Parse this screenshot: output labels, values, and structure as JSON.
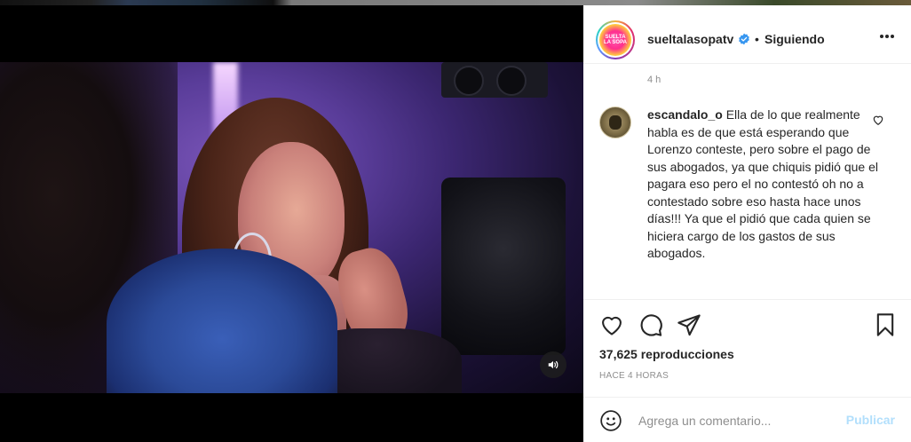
{
  "post": {
    "username": "sueltalasopatv",
    "follow_status": "Siguiendo",
    "separator": "•",
    "avatar_text": "SUELTA LA SOPA",
    "verified_icon": "verified-badge-icon",
    "more_icon": "more-options-icon"
  },
  "comments": {
    "cut_time": "4 h",
    "items": [
      {
        "username": "escandalo_o",
        "text": "Ella de lo que realmente habla es de que está esperando que Lorenzo conteste, pero sobre el pago de sus abogados, ya que chiquis pidió que el pagara eso pero el no contestó oh no a contestado sobre eso hasta hace unos días!!! Ya que el pidió que cada quien se hiciera cargo de los gastos de sus abogados."
      }
    ]
  },
  "actions": {
    "views_count": "37,625",
    "views_label": "reproducciones",
    "time_ago": "HACE 4 HORAS",
    "icons": [
      "heart-icon",
      "comment-icon",
      "share-icon",
      "bookmark-icon"
    ]
  },
  "add_comment": {
    "placeholder": "Agrega un comentario...",
    "publish_label": "Publicar",
    "emoji_icon": "emoji-icon"
  },
  "video": {
    "sound_icon": "volume-icon"
  },
  "colors": {
    "text": "#262626",
    "muted": "#8e8e8e",
    "publish_disabled": "#b2dffc",
    "verified": "#3897f0"
  }
}
